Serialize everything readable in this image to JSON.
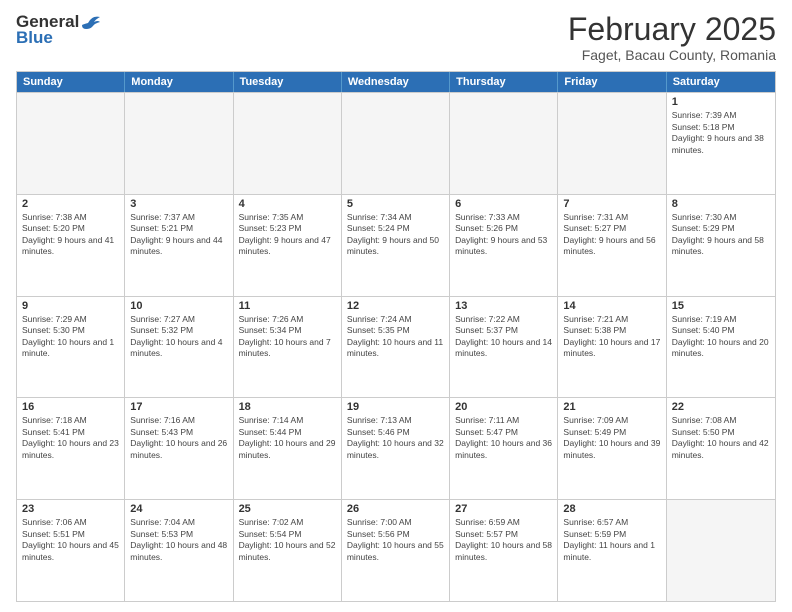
{
  "header": {
    "logo_general": "General",
    "logo_blue": "Blue",
    "title": "February 2025",
    "subtitle": "Faget, Bacau County, Romania"
  },
  "weekdays": [
    "Sunday",
    "Monday",
    "Tuesday",
    "Wednesday",
    "Thursday",
    "Friday",
    "Saturday"
  ],
  "weeks": [
    [
      {
        "day": "",
        "info": ""
      },
      {
        "day": "",
        "info": ""
      },
      {
        "day": "",
        "info": ""
      },
      {
        "day": "",
        "info": ""
      },
      {
        "day": "",
        "info": ""
      },
      {
        "day": "",
        "info": ""
      },
      {
        "day": "1",
        "info": "Sunrise: 7:39 AM\nSunset: 5:18 PM\nDaylight: 9 hours and 38 minutes."
      }
    ],
    [
      {
        "day": "2",
        "info": "Sunrise: 7:38 AM\nSunset: 5:20 PM\nDaylight: 9 hours and 41 minutes."
      },
      {
        "day": "3",
        "info": "Sunrise: 7:37 AM\nSunset: 5:21 PM\nDaylight: 9 hours and 44 minutes."
      },
      {
        "day": "4",
        "info": "Sunrise: 7:35 AM\nSunset: 5:23 PM\nDaylight: 9 hours and 47 minutes."
      },
      {
        "day": "5",
        "info": "Sunrise: 7:34 AM\nSunset: 5:24 PM\nDaylight: 9 hours and 50 minutes."
      },
      {
        "day": "6",
        "info": "Sunrise: 7:33 AM\nSunset: 5:26 PM\nDaylight: 9 hours and 53 minutes."
      },
      {
        "day": "7",
        "info": "Sunrise: 7:31 AM\nSunset: 5:27 PM\nDaylight: 9 hours and 56 minutes."
      },
      {
        "day": "8",
        "info": "Sunrise: 7:30 AM\nSunset: 5:29 PM\nDaylight: 9 hours and 58 minutes."
      }
    ],
    [
      {
        "day": "9",
        "info": "Sunrise: 7:29 AM\nSunset: 5:30 PM\nDaylight: 10 hours and 1 minute."
      },
      {
        "day": "10",
        "info": "Sunrise: 7:27 AM\nSunset: 5:32 PM\nDaylight: 10 hours and 4 minutes."
      },
      {
        "day": "11",
        "info": "Sunrise: 7:26 AM\nSunset: 5:34 PM\nDaylight: 10 hours and 7 minutes."
      },
      {
        "day": "12",
        "info": "Sunrise: 7:24 AM\nSunset: 5:35 PM\nDaylight: 10 hours and 11 minutes."
      },
      {
        "day": "13",
        "info": "Sunrise: 7:22 AM\nSunset: 5:37 PM\nDaylight: 10 hours and 14 minutes."
      },
      {
        "day": "14",
        "info": "Sunrise: 7:21 AM\nSunset: 5:38 PM\nDaylight: 10 hours and 17 minutes."
      },
      {
        "day": "15",
        "info": "Sunrise: 7:19 AM\nSunset: 5:40 PM\nDaylight: 10 hours and 20 minutes."
      }
    ],
    [
      {
        "day": "16",
        "info": "Sunrise: 7:18 AM\nSunset: 5:41 PM\nDaylight: 10 hours and 23 minutes."
      },
      {
        "day": "17",
        "info": "Sunrise: 7:16 AM\nSunset: 5:43 PM\nDaylight: 10 hours and 26 minutes."
      },
      {
        "day": "18",
        "info": "Sunrise: 7:14 AM\nSunset: 5:44 PM\nDaylight: 10 hours and 29 minutes."
      },
      {
        "day": "19",
        "info": "Sunrise: 7:13 AM\nSunset: 5:46 PM\nDaylight: 10 hours and 32 minutes."
      },
      {
        "day": "20",
        "info": "Sunrise: 7:11 AM\nSunset: 5:47 PM\nDaylight: 10 hours and 36 minutes."
      },
      {
        "day": "21",
        "info": "Sunrise: 7:09 AM\nSunset: 5:49 PM\nDaylight: 10 hours and 39 minutes."
      },
      {
        "day": "22",
        "info": "Sunrise: 7:08 AM\nSunset: 5:50 PM\nDaylight: 10 hours and 42 minutes."
      }
    ],
    [
      {
        "day": "23",
        "info": "Sunrise: 7:06 AM\nSunset: 5:51 PM\nDaylight: 10 hours and 45 minutes."
      },
      {
        "day": "24",
        "info": "Sunrise: 7:04 AM\nSunset: 5:53 PM\nDaylight: 10 hours and 48 minutes."
      },
      {
        "day": "25",
        "info": "Sunrise: 7:02 AM\nSunset: 5:54 PM\nDaylight: 10 hours and 52 minutes."
      },
      {
        "day": "26",
        "info": "Sunrise: 7:00 AM\nSunset: 5:56 PM\nDaylight: 10 hours and 55 minutes."
      },
      {
        "day": "27",
        "info": "Sunrise: 6:59 AM\nSunset: 5:57 PM\nDaylight: 10 hours and 58 minutes."
      },
      {
        "day": "28",
        "info": "Sunrise: 6:57 AM\nSunset: 5:59 PM\nDaylight: 11 hours and 1 minute."
      },
      {
        "day": "",
        "info": ""
      }
    ]
  ]
}
